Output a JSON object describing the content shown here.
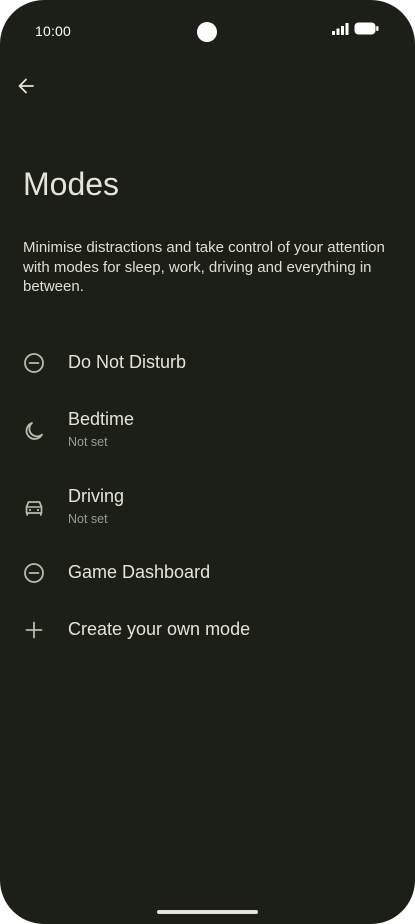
{
  "status_bar": {
    "time": "10:00"
  },
  "header": {
    "back_icon": "arrow-back-icon",
    "title": "Modes",
    "description": "Minimise distractions and take control of your attention with modes for sleep, work, driving and everything in between."
  },
  "modes": [
    {
      "icon": "do-not-disturb-icon",
      "title": "Do Not Disturb",
      "subtitle": ""
    },
    {
      "icon": "moon-icon",
      "title": "Bedtime",
      "subtitle": "Not set"
    },
    {
      "icon": "car-icon",
      "title": "Driving",
      "subtitle": "Not set"
    },
    {
      "icon": "do-not-disturb-icon",
      "title": "Game Dashboard",
      "subtitle": ""
    },
    {
      "icon": "plus-icon",
      "title": "Create your own mode",
      "subtitle": ""
    }
  ],
  "colors": {
    "background": "#1c1f17",
    "text_primary": "#e6e3d9",
    "text_secondary": "#9a9b90",
    "icon": "#b9bbae"
  }
}
